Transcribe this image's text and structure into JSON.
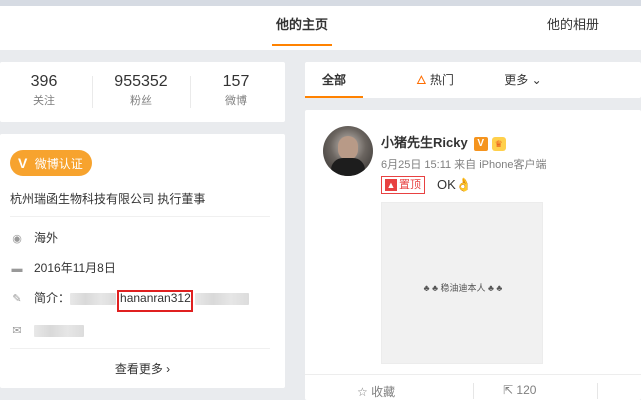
{
  "tabs": {
    "home": "他的主页",
    "album": "他的相册"
  },
  "stats": [
    {
      "num": "396",
      "label": "关注"
    },
    {
      "num": "955352",
      "label": "粉丝"
    },
    {
      "num": "157",
      "label": "微博"
    }
  ],
  "profile": {
    "verify_label": "微博认证",
    "verify_mark": "V",
    "company": "杭州瑞函生物科技有限公司 执行董事",
    "location": "海外",
    "birthday": "2016年11月8日",
    "bio_label": "简介：",
    "bio_value": "hananran312",
    "more": "查看更多 ›"
  },
  "icons": {
    "location": "location-pin-icon",
    "birthday": "cake-icon",
    "bio": "edit-icon",
    "mail": "mail-icon"
  },
  "filters": {
    "all": "全部",
    "hot": "热门",
    "more": "更多 ⌄"
  },
  "post": {
    "username": "小猪先生Ricky",
    "verified_mark": "V",
    "meta": "6月25日 15:11 来自 iPhone客户端",
    "pinned": "置顶",
    "text": "OK👌",
    "image_watermark": "♣ ♣ 稳油迪本人 ♣ ♣",
    "favorite": "收藏",
    "share_count": "120"
  },
  "colors": {
    "accent": "#ff8200",
    "verify": "#f7a32e",
    "highlight": "#e02020"
  }
}
